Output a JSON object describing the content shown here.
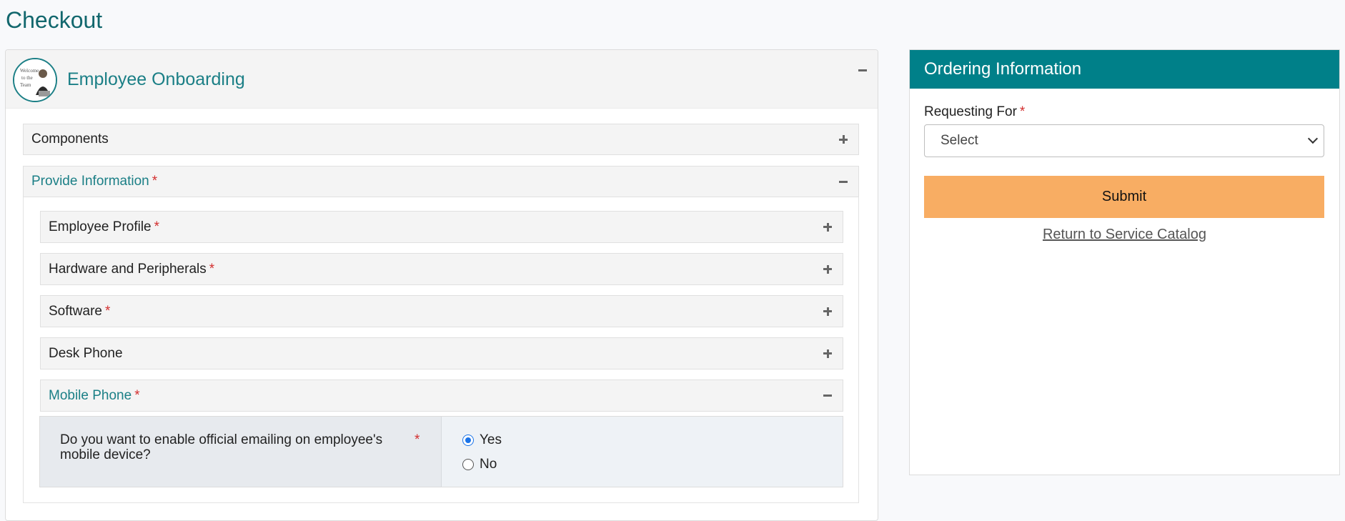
{
  "page": {
    "title": "Checkout"
  },
  "catalog_item": {
    "title": "Employee Onboarding",
    "avatar_icon": "person-photo-icon",
    "collapse_icon": "minus-icon"
  },
  "sections": {
    "components": {
      "label": "Components",
      "icon": "plus-icon"
    },
    "provide_information": {
      "label": "Provide Information",
      "required_mark": "*",
      "icon": "minus-icon",
      "subsections": [
        {
          "label": "Employee Profile",
          "required_mark": "*",
          "icon": "plus-icon"
        },
        {
          "label": "Hardware and Peripherals",
          "required_mark": "*",
          "icon": "plus-icon"
        },
        {
          "label": "Software",
          "required_mark": "*",
          "icon": "plus-icon"
        },
        {
          "label": "Desk Phone",
          "required_mark": "",
          "icon": "plus-icon"
        },
        {
          "label": "Mobile Phone",
          "required_mark": "*",
          "icon": "minus-icon"
        }
      ]
    }
  },
  "mobile_question": {
    "text": "Do you want to enable official emailing on employee's mobile device?",
    "required_mark": "*",
    "options": [
      {
        "label": "Yes",
        "checked": true
      },
      {
        "label": "No",
        "checked": false
      }
    ]
  },
  "ordering": {
    "header": "Ordering Information",
    "requesting_for_label": "Requesting For",
    "required_mark": "*",
    "select_value": "Select",
    "submit_label": "Submit",
    "return_link": "Return to Service Catalog"
  },
  "colors": {
    "accent": "#1b7f86",
    "header_teal": "#008089",
    "submit": "#f8ad63",
    "required": "#d32f2f"
  }
}
